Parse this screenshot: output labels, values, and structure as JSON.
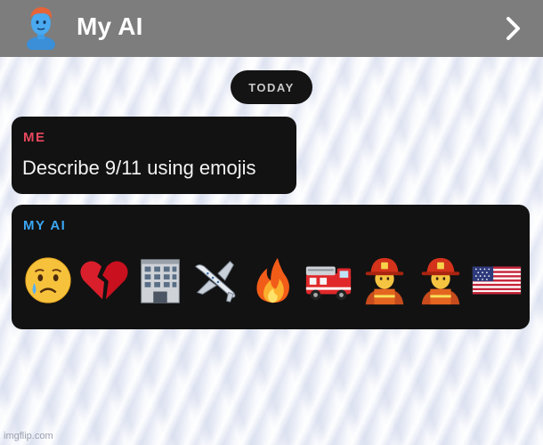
{
  "header": {
    "title": "My AI",
    "avatar_icon": "bitmoji-avatar-icon",
    "chevron_icon": "chevron-right-icon",
    "background_color": "#7d7d7d"
  },
  "date_separator": "TODAY",
  "messages": [
    {
      "sender": "ME",
      "sender_color": "#e8475d",
      "text": "Describe 9/11 using emojis"
    },
    {
      "sender": "MY AI",
      "sender_color": "#3ba6f1",
      "emojis": [
        "crying-face-emoji",
        "broken-heart-emoji",
        "office-building-emoji",
        "airplane-emoji",
        "fire-emoji",
        "fire-engine-emoji",
        "firefighter-emoji",
        "firefighter-emoji",
        "us-flag-emoji"
      ]
    }
  ],
  "watermark": "imgflip.com"
}
